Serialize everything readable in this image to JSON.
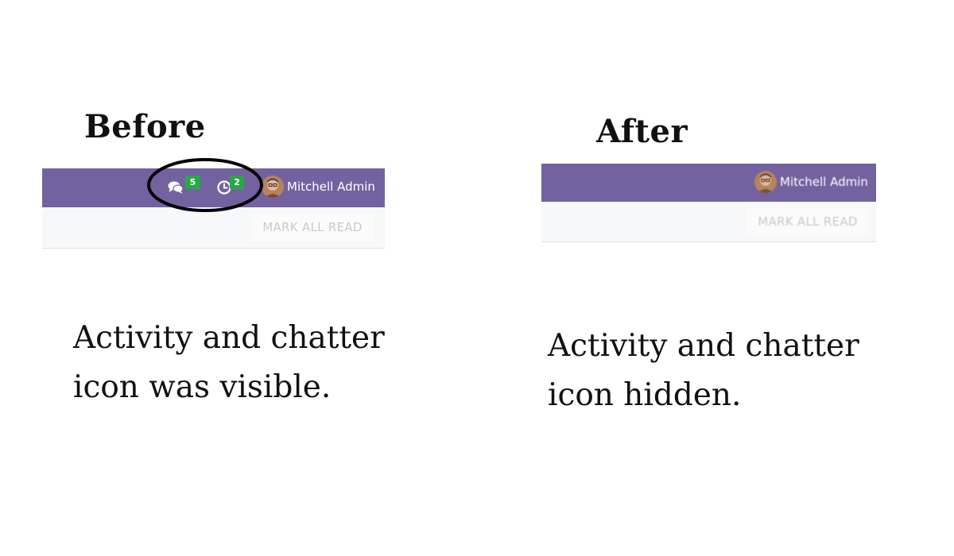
{
  "before": {
    "title": "Before",
    "navbar": {
      "user_name": "Mitchell Admin",
      "chat_icon": "comments-icon",
      "chat_count": "5",
      "activity_icon": "clock-icon",
      "activity_count": "2"
    },
    "mark_all_read": "MARK ALL READ",
    "caption": {
      "line1": "Activity and chatter",
      "line2": "icon was visible."
    }
  },
  "after": {
    "title": "After",
    "navbar": {
      "user_name": "Mitchell Admin"
    },
    "mark_all_read": "MARK ALL READ",
    "caption": {
      "line1": "Activity and chatter",
      "line2": "icon hidden."
    }
  },
  "colors": {
    "navbar": "#7462a0",
    "badge": "#28a745",
    "subbar": "#f7f8fa",
    "annotation": "#000000"
  }
}
